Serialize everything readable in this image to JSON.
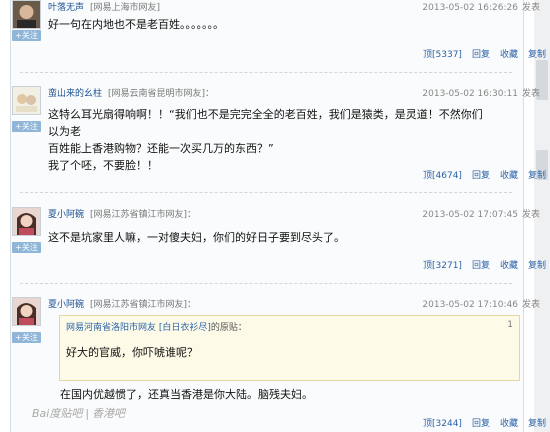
{
  "posts": [
    {
      "username": "叶落无声",
      "source": "[网易上海市网友]",
      "time": "2013-05-02 16:26:26",
      "publish": "发表",
      "content_lines": [
        "好一句在内地也不是老百姓。。。。。。。"
      ],
      "follow": "+关注",
      "actions": {
        "up": "顶[5337]",
        "reply": "回复",
        "collect": "收藏",
        "copy": "复制"
      }
    },
    {
      "username": "蛮山来的幺柱",
      "source": "[网易云南省昆明市网友]：",
      "time": "2013-05-02 16:30:11",
      "publish": "发表",
      "content_lines": [
        "这特么耳光扇得响啊！！“我们也不是完完全全的老百姓，我们是猿类，是灵道！不然你们以为老",
        "百姓能上香港购物？还能一次买几万的东西？”",
        "我了个呸，不要脸！！"
      ],
      "follow": "+关注",
      "actions": {
        "up": "顶[4674]",
        "reply": "回复",
        "collect": "收藏",
        "copy": "复制"
      }
    },
    {
      "username": "夏小阿碗",
      "source": "[网易江苏省镇江市网友]：",
      "time": "2013-05-02 17:07:45",
      "publish": "发表",
      "content_lines": [
        "这不是坑家里人嘛，一对傻夫妇，你们的好日子要到尽头了。"
      ],
      "follow": "+关注",
      "actions": {
        "up": "顶[3271]",
        "reply": "回复",
        "collect": "收藏",
        "copy": "复制"
      }
    },
    {
      "username": "夏小阿碗",
      "source": "[网易江苏省镇江市网友]：",
      "time": "2013-05-02 17:10:46",
      "publish": "发表",
      "quote": {
        "header": "网易河南省洛阳市网友 [白日衣衫尽]",
        "suffix": "的原贴：",
        "num": "1",
        "text": "好大的官威，你吓唬谁呢？"
      },
      "content_lines": [
        "在国内优越惯了，还真当香港是你大陆。脑残夫妇。"
      ],
      "follow": "+关注",
      "actions": {
        "up": "顶[3244]",
        "reply": "回复",
        "collect": "收藏",
        "copy": "复制"
      }
    }
  ],
  "watermark": {
    "brand": "Bai度贴吧",
    "sep": "|",
    "bar": "香港吧"
  }
}
